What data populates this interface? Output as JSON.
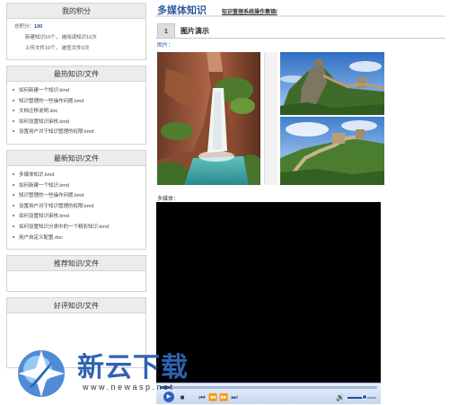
{
  "sidebar": {
    "score_box": {
      "title": "我的积分",
      "total_label": "总积分：",
      "total_value": "100",
      "line1": "新建知识10个， 被阅读知识10次",
      "line2": "上传文件10个， 被查文件0次"
    },
    "hot_box": {
      "title": "最热知识/文件",
      "items": [
        "如何新建一个知识.kmd",
        "知识管理的一些操作问题.kmd",
        "文档迁移说明.doc",
        "如何设置知识审核.kmd",
        "设置用户对于知识管理的权限.kmd"
      ]
    },
    "latest_box": {
      "title": "最新知识/文件",
      "items": [
        "多媒体知识.kmd",
        "如何新建一个知识.kmd",
        "知识管理的一些操作问题.kmd",
        "设置用户对于知识管理的权限.kmd",
        "如何设置知识审核.kmd",
        "如何设置知识分类中的一个精彩知识.kmd",
        "用户自定义配置.doc"
      ]
    },
    "recommend_box": {
      "title": "推荐知识/文件"
    },
    "rated_box": {
      "title": "好评知识/文件"
    }
  },
  "main": {
    "title": "多媒体知识",
    "link": "知识管理系统操作集锦/",
    "section_number": "1",
    "section_title": "图片演示",
    "images_caption": "图片：",
    "media_caption": "多媒体：",
    "images": {
      "large": "waterfall-photo",
      "top_right": "great-wall-photo",
      "bottom_right": "great-wall-photo"
    }
  },
  "player": {
    "icons": [
      "play-icon",
      "stop-icon",
      "previous-icon",
      "rewind-icon",
      "fast-forward-icon",
      "next-icon",
      "volume-icon"
    ],
    "progress": 0.05,
    "volume": 0.6
  },
  "watermark": {
    "text": "新云下载",
    "url": "www.newasp.net"
  },
  "colors": {
    "accent": "#2d5a9c",
    "link_blue": "#3a62a8",
    "header_bg": "#ececec"
  }
}
